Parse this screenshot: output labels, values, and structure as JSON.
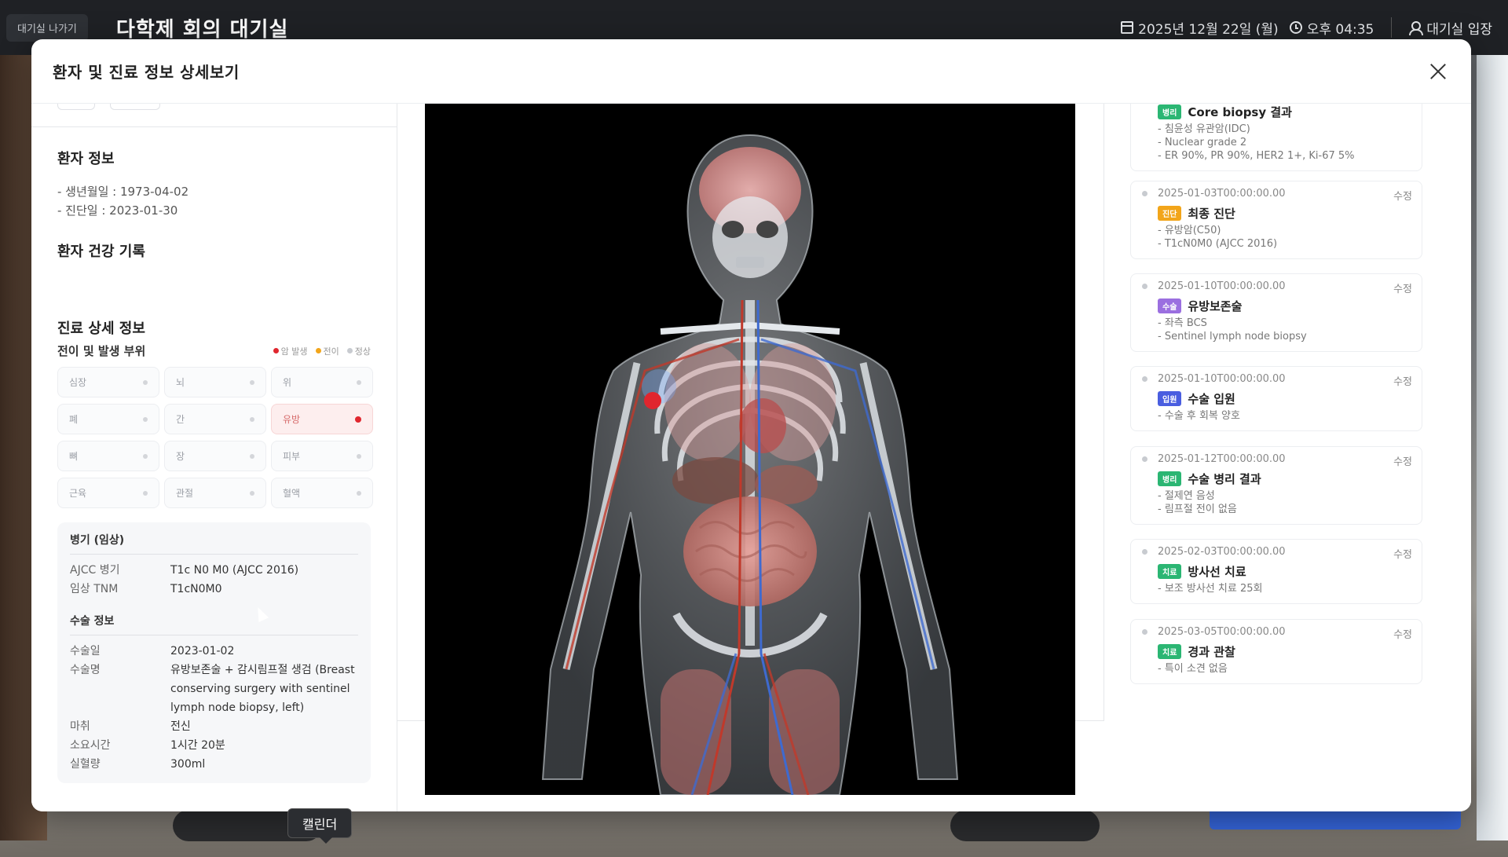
{
  "topbar": {
    "exit_label": "대기실 나가기",
    "title": "다학제 회의 대기실",
    "date": "2025년 12월 22일 (월)",
    "time": "오후 04:35",
    "enter_label": "대기실 입장"
  },
  "modal": {
    "title": "환자 및 진료 정보 상세보기"
  },
  "patient_info": {
    "title": "환자 정보",
    "birth": "- 생년월일 : 1973-04-02",
    "diagnosis_date": "- 진단일 : 2023-01-30"
  },
  "health_record": {
    "title": "환자 건강 기록"
  },
  "care_detail": {
    "title": "진료 상세 정보",
    "sites_label": "전이 및 발생 부위",
    "legend": [
      {
        "label": "암 발생",
        "color": "#e0262e"
      },
      {
        "label": "전이",
        "color": "#f2a51a"
      },
      {
        "label": "정상",
        "color": "#c8cbd0"
      }
    ],
    "organs": [
      "심장",
      "뇌",
      "위",
      "폐",
      "간",
      "유방",
      "뼈",
      "장",
      "피부",
      "근육",
      "관절",
      "혈액"
    ],
    "active_organ": "유방"
  },
  "staging": {
    "title": "병기 (임상)",
    "rows": [
      {
        "k": "AJCC 병기",
        "v": "T1c N0 M0 (AJCC 2016)"
      },
      {
        "k": "임상 TNM",
        "v": "T1cN0M0"
      }
    ]
  },
  "surgery": {
    "title": "수술 정보",
    "rows": [
      {
        "k": "수술일",
        "v": "2023-01-02"
      },
      {
        "k": "수술명",
        "v": "유방보존술 + 감시림프절 생검 (Breast conserving surgery with sentinel lymph node biopsy, left)"
      },
      {
        "k": "마취",
        "v": "전신"
      },
      {
        "k": "소요시간",
        "v": "1시간 20분"
      },
      {
        "k": "실혈량",
        "v": "300ml"
      }
    ]
  },
  "timeline": {
    "first_partial": {
      "tag": "병리",
      "title": "Core biopsy 결과",
      "notes": [
        "- 침윤성 유관암(IDC)",
        "- Nuclear grade 2",
        "- ER 90%, PR 90%, HER2 1+, Ki-67 5%"
      ]
    },
    "edit_label": "수정",
    "items": [
      {
        "date": "2025-01-03T00:00:00.00",
        "tag": "진단",
        "tag_color": "#f2a51a",
        "title": "최종 진단",
        "notes": [
          "- 유방암(C50)",
          "- T1cN0M0 (AJCC 2016)"
        ]
      },
      {
        "date": "2025-01-10T00:00:00.00",
        "tag": "수술",
        "tag_color": "#9b6fe0",
        "title": "유방보존술",
        "notes": [
          "- 좌측 BCS",
          "- Sentinel lymph node biopsy"
        ]
      },
      {
        "date": "2025-01-10T00:00:00.00",
        "tag": "입원",
        "tag_color": "#4a5ee0",
        "title": "수술 입원",
        "notes": [
          "- 수술 후 회복 양호"
        ]
      },
      {
        "date": "2025-01-12T00:00:00.00",
        "tag": "병리",
        "tag_color": "#2bb673",
        "title": "수술 병리 결과",
        "notes": [
          "- 절제연 음성",
          "- 림프절 전이 없음"
        ]
      },
      {
        "date": "2025-02-03T00:00:00.00",
        "tag": "치료",
        "tag_color": "#2bb673",
        "title": "방사선 치료",
        "notes": [
          "- 보조 방사선 치료 25회"
        ]
      },
      {
        "date": "2025-03-05T00:00:00.00",
        "tag": "치료",
        "tag_color": "#2bb673",
        "title": "경과 관찰",
        "notes": [
          "- 특이 소견 없음"
        ]
      }
    ]
  },
  "tooltip": {
    "label": "캘린더"
  },
  "icons": {
    "calendar": "calendar-icon",
    "clock": "clock-icon",
    "users": "users-icon",
    "close": "close-icon"
  }
}
